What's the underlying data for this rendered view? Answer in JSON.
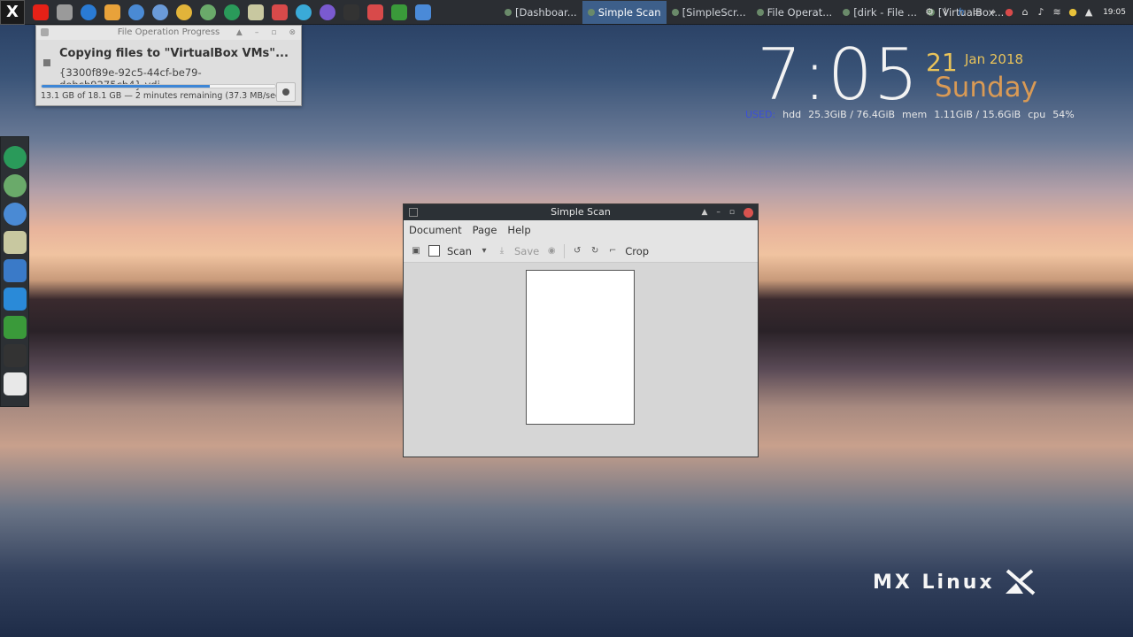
{
  "taskbar": {
    "start_label": "X",
    "launchers": [
      {
        "name": "youtube-icon",
        "color": "#e62117",
        "round": false
      },
      {
        "name": "screenshot-icon",
        "color": "#9a9a9a",
        "round": false
      },
      {
        "name": "search-icon",
        "color": "#2a7bd4",
        "round": true
      },
      {
        "name": "download-icon",
        "color": "#e8a23a",
        "round": false
      },
      {
        "name": "thunderbird-icon",
        "color": "#4a8ad4",
        "round": true
      },
      {
        "name": "browser-icon",
        "color": "#6a9ad8",
        "round": true
      },
      {
        "name": "chrome-icon",
        "color": "#e2b43a",
        "round": true
      },
      {
        "name": "network-globe-icon",
        "color": "#6aaa6a",
        "round": true
      },
      {
        "name": "green-app-icon",
        "color": "#2a9a5a",
        "round": true
      },
      {
        "name": "file-manager-icon",
        "color": "#c8c8a0",
        "round": false
      },
      {
        "name": "upload-icon",
        "color": "#d84a4a",
        "round": false
      },
      {
        "name": "d-app-icon",
        "color": "#3aaad8",
        "round": true
      },
      {
        "name": "viber-icon",
        "color": "#7a5ad0",
        "round": true
      },
      {
        "name": "terminal-icon",
        "color": "#333333",
        "round": false
      },
      {
        "name": "screencast-icon",
        "color": "#d84a4a",
        "round": false
      },
      {
        "name": "chart-app-icon",
        "color": "#3a9a3a",
        "round": false
      },
      {
        "name": "window-icon",
        "color": "#4a8ad8",
        "round": false
      }
    ],
    "tasks": [
      {
        "label": "[Dashboar...",
        "active": false
      },
      {
        "label": "Simple Scan",
        "active": true
      },
      {
        "label": "[SimpleScr...",
        "active": false
      },
      {
        "label": "File Operat...",
        "active": false
      },
      {
        "label": "[dirk - File ...",
        "active": false
      },
      {
        "label": "[VirtualBox...",
        "active": false
      }
    ],
    "clock": "19:05"
  },
  "fileop": {
    "title": "File Operation Progress",
    "heading": "Copying files to \"VirtualBox VMs\"...",
    "filename": "{3300f89e-92c5-44cf-be79-debcb9275cb4}.vdi",
    "status": "13.1 GB of 18.1 GB — 2 minutes remaining (37.3 MB/sec)",
    "progress": 0.72
  },
  "conky": {
    "time": "7:05",
    "day": "21",
    "monyear": "Jan 2018",
    "weekday": "Sunday",
    "used_label": "USED:",
    "hdd_label": "hdd",
    "hdd_value": "25.3GiB / 76.4GiB",
    "mem_label": "mem",
    "mem_value": "1.11GiB / 15.6GiB",
    "cpu_label": "cpu",
    "cpu_value": "54%"
  },
  "dock": [
    {
      "name": "dock-green-app-icon",
      "color": "#2a9a5a",
      "round": true
    },
    {
      "name": "dock-globe-icon",
      "color": "#6aaa6a",
      "round": true
    },
    {
      "name": "dock-thunderbird-icon",
      "color": "#4a8ad4",
      "round": true
    },
    {
      "name": "dock-file-manager-icon",
      "color": "#c8c8a0",
      "round": false
    },
    {
      "name": "dock-mx-tools-icon",
      "color": "#3a7ac8",
      "round": false
    },
    {
      "name": "dock-notes-icon",
      "color": "#2a8ad8",
      "round": false
    },
    {
      "name": "dock-trash-icon",
      "color": "#3a9a3a",
      "round": false
    },
    {
      "name": "dock-terminal-icon",
      "color": "#333333",
      "round": false
    },
    {
      "name": "dock-editor-icon",
      "color": "#e8e8e8",
      "round": false
    }
  ],
  "scan": {
    "title": "Simple Scan",
    "menu": [
      "Document",
      "Page",
      "Help"
    ],
    "scan_label": "Scan",
    "save_label": "Save",
    "crop_label": "Crop"
  },
  "logo": {
    "text": "MX Linux"
  }
}
